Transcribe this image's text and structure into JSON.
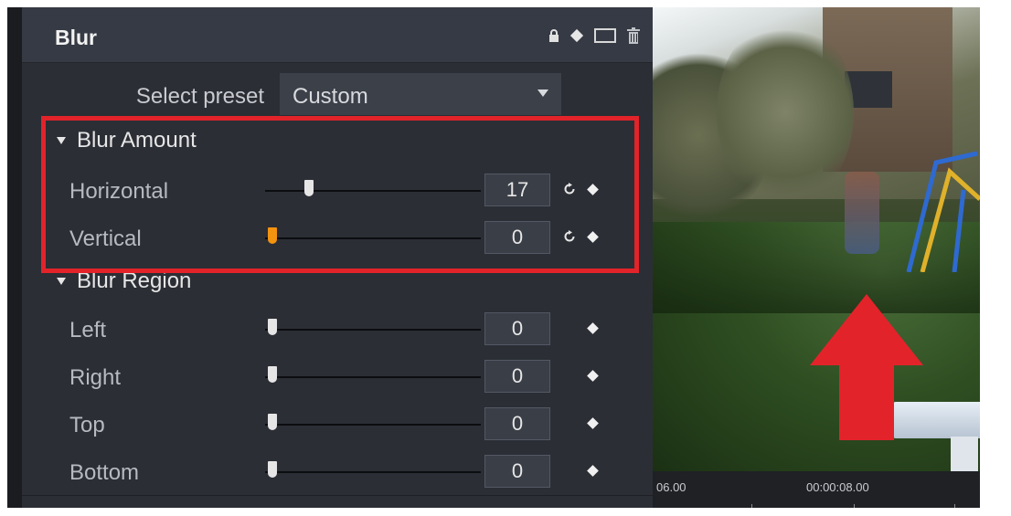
{
  "panel": {
    "title": "Blur",
    "header_icons": [
      "lock-icon",
      "keyframe-icon",
      "image-icon",
      "trash-icon"
    ]
  },
  "preset": {
    "label": "Select preset",
    "value": "Custom"
  },
  "sections": [
    {
      "title": "Blur Amount",
      "params": [
        {
          "label": "Horizontal",
          "value": "17",
          "slider_fraction": 0.17,
          "has_reset": true
        },
        {
          "label": "Vertical",
          "value": "0",
          "slider_fraction": 0.0,
          "has_reset": true
        }
      ]
    },
    {
      "title": "Blur Region",
      "params": [
        {
          "label": "Left",
          "value": "0",
          "slider_fraction": 0.0,
          "has_reset": false
        },
        {
          "label": "Right",
          "value": "0",
          "slider_fraction": 0.0,
          "has_reset": false
        },
        {
          "label": "Top",
          "value": "0",
          "slider_fraction": 0.0,
          "has_reset": false
        },
        {
          "label": "Bottom",
          "value": "0",
          "slider_fraction": 0.0,
          "has_reset": false
        }
      ]
    }
  ],
  "timeline": {
    "left_time": "06.00",
    "right_time": "00:00:08.00"
  },
  "colors": {
    "accent_slider": "#f3930f",
    "highlight": "#e3232a",
    "arrow": "#e3232a"
  }
}
